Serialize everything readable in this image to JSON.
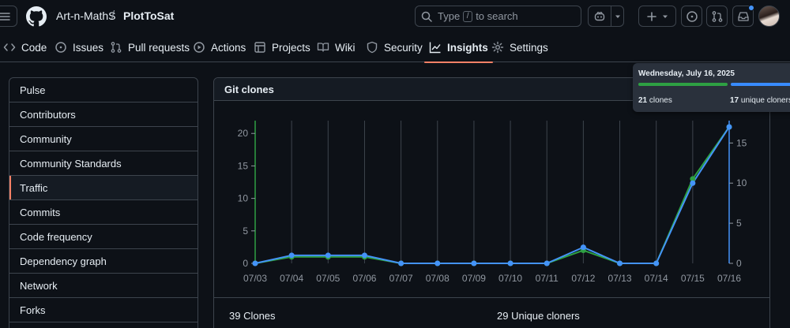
{
  "header": {
    "owner": "Art-n-MathS",
    "separator": "/",
    "repo": "PlotToSat",
    "search_prefix": "Type",
    "search_key": "/",
    "search_suffix": "to search"
  },
  "tabs": [
    {
      "label": "Code",
      "icon": "code-icon"
    },
    {
      "label": "Issues",
      "icon": "issue-icon"
    },
    {
      "label": "Pull requests",
      "icon": "pull-request-icon"
    },
    {
      "label": "Actions",
      "icon": "play-icon"
    },
    {
      "label": "Projects",
      "icon": "table-icon"
    },
    {
      "label": "Wiki",
      "icon": "book-icon"
    },
    {
      "label": "Security",
      "icon": "shield-icon"
    },
    {
      "label": "Insights",
      "icon": "graph-icon",
      "active": true
    },
    {
      "label": "Settings",
      "icon": "gear-icon"
    }
  ],
  "sidebar": {
    "items": [
      {
        "label": "Pulse"
      },
      {
        "label": "Contributors"
      },
      {
        "label": "Community"
      },
      {
        "label": "Community Standards"
      },
      {
        "label": "Traffic",
        "selected": true
      },
      {
        "label": "Commits"
      },
      {
        "label": "Code frequency"
      },
      {
        "label": "Dependency graph"
      },
      {
        "label": "Network"
      },
      {
        "label": "Forks"
      }
    ]
  },
  "panel": {
    "title": "Git clones",
    "clones_total": "39 Clones",
    "unique_total": "29 Unique cloners"
  },
  "tooltip": {
    "date": "Wednesday, July 16, 2025",
    "clones_value": "21",
    "clones_label": "clones",
    "unique_value": "17",
    "unique_label": "unique cloners"
  },
  "colors": {
    "clones": "#2ea043",
    "unique": "#4493f8",
    "accent": "#f78166"
  },
  "chart_data": {
    "type": "line",
    "categories": [
      "07/03",
      "07/04",
      "07/05",
      "07/06",
      "07/07",
      "07/08",
      "07/09",
      "07/10",
      "07/11",
      "07/12",
      "07/13",
      "07/14",
      "07/15",
      "07/16"
    ],
    "series": [
      {
        "name": "clones",
        "values": [
          0,
          1,
          1,
          1,
          0,
          0,
          0,
          0,
          0,
          2,
          0,
          0,
          13,
          21
        ],
        "axis": "left",
        "color": "#2ea043"
      },
      {
        "name": "unique cloners",
        "values": [
          0,
          1,
          1,
          1,
          0,
          0,
          0,
          0,
          0,
          2,
          0,
          0,
          10,
          17
        ],
        "axis": "right",
        "color": "#4493f8"
      }
    ],
    "y_left": {
      "ticks": [
        0,
        5,
        10,
        15,
        20
      ],
      "range": [
        0,
        21
      ]
    },
    "y_right": {
      "ticks": [
        0,
        5,
        10,
        15
      ],
      "range": [
        0,
        17
      ]
    },
    "grid": "vertical"
  }
}
